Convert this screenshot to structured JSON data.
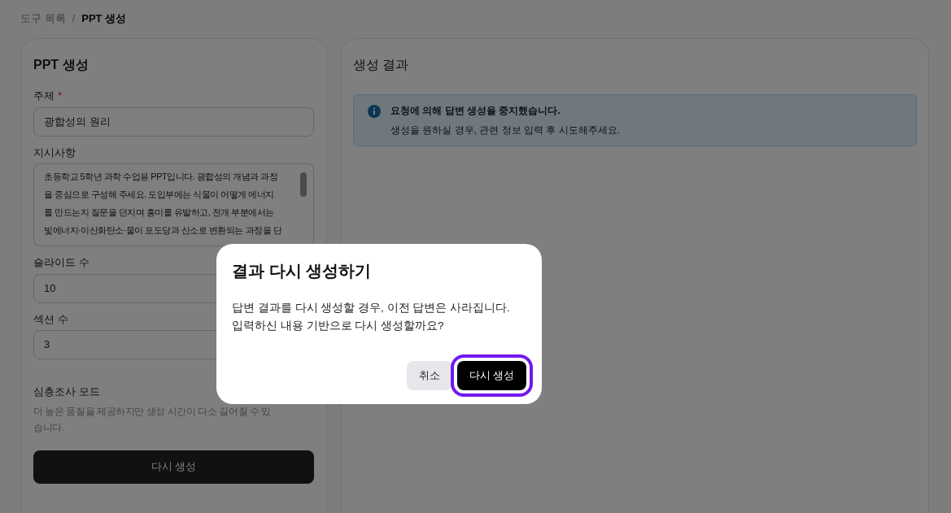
{
  "breadcrumb_separator": "/",
  "breadcrumb": [
    {
      "label": "도구 목록",
      "current": false
    },
    {
      "label": "PPT 생성",
      "current": true
    }
  ],
  "form": {
    "title": "PPT 생성",
    "required_mark": "*",
    "fields": [
      {
        "kind": "input",
        "label": "주제",
        "required": true,
        "value": "광합성의 원리"
      },
      {
        "kind": "textarea",
        "label": "지시사항",
        "required": false,
        "lines": [
          "초등학교 5학년 과학 수업용 PPT입니다. 광합성의 개념과 과정",
          "을 중심으로 구성해 주세요. 도입부에는 식물이 어떻게 에너지",
          "를 만드는지 질문을 던지며 흥미를 유발하고, 전개 부분에서는",
          "빛에너지·이산화탄소·물이 포도당과 산소로 변환되는 과정을 단"
        ]
      },
      {
        "kind": "input",
        "label": "슬라이드 수",
        "required": false,
        "value": "10"
      },
      {
        "kind": "input",
        "label": "섹션 수",
        "required": false,
        "value": "3"
      }
    ],
    "deep_mode": {
      "label": "심층조사 모드",
      "description": "더 높은 품질을 제공하지만 생성 시간이 다소 길어질 수 있습니다."
    },
    "submit": "다시 생성"
  },
  "result": {
    "title": "생성 결과",
    "alert": {
      "title": "요청에 의해 답변 생성을 중지했습니다.",
      "message": "생성을 원하실 경우, 관련 정보 입력 후 시도해주세요."
    }
  },
  "dialog": {
    "title": "결과 다시 생성하기",
    "lines": [
      "답변 결과를 다시 생성할 경우, 이전 답변은 사라집니다.",
      "입력하신 내용 기반으로 다시 생성할까요?"
    ],
    "buttons": [
      {
        "kind": "secondary",
        "label": "취소",
        "focused": false
      },
      {
        "kind": "primary",
        "label": "다시 생성",
        "focused": true
      }
    ]
  }
}
